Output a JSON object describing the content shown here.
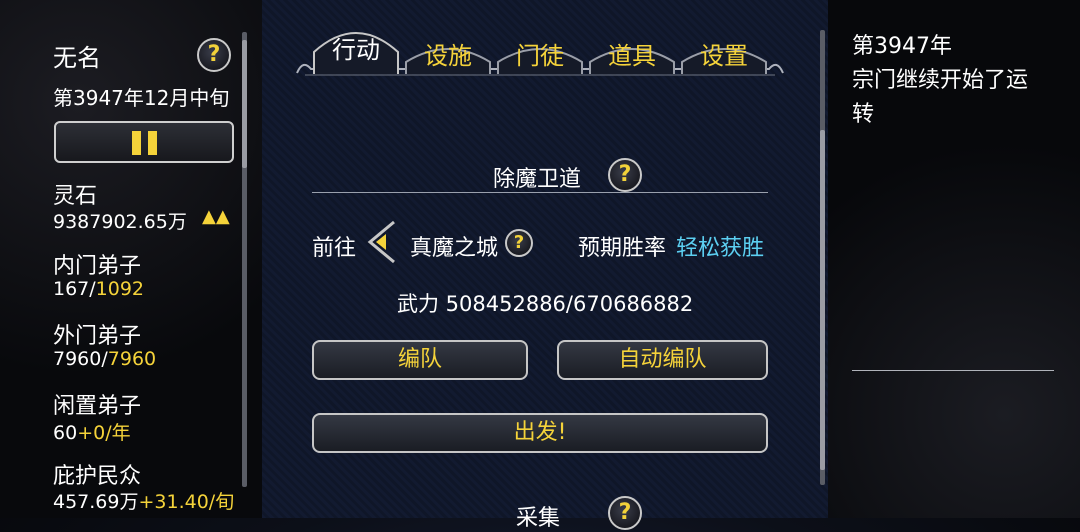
{
  "left_panel": {
    "sect_name": "无名",
    "date": "第3947年12月中旬",
    "stats": [
      {
        "label": "灵石",
        "value": "9387902.65万",
        "extra": "▲▲"
      },
      {
        "label": "内门弟子",
        "value": "167/",
        "extra": "1092"
      },
      {
        "label": "外门弟子",
        "value": "7960/",
        "extra": "7960"
      },
      {
        "label": "闲置弟子",
        "value": "60",
        "extra": "+0/年"
      },
      {
        "label": "庇护民众",
        "value": "457.69万",
        "extra": "+31.40/旬"
      }
    ]
  },
  "tabs": [
    {
      "label": "行动",
      "active": true
    },
    {
      "label": "设施",
      "active": false
    },
    {
      "label": "门徒",
      "active": false
    },
    {
      "label": "道具",
      "active": false
    },
    {
      "label": "设置",
      "active": false
    }
  ],
  "mission": {
    "title": "除魔卫道",
    "go_label": "前往",
    "destination": "真魔之城",
    "win_rate_label": "预期胜率",
    "win_rate_value": "轻松获胜",
    "power": "武力 508452886/670686882",
    "team_button": "编队",
    "auto_team_button": "自动编队",
    "depart_button": "出发!",
    "next_section": "采集"
  },
  "log": {
    "year": "第3947年",
    "message_line1": "宗门继续开始了运",
    "message_line2": "转"
  },
  "colors": {
    "accent": "#f5d33a",
    "cyan": "#5cd0f2"
  }
}
